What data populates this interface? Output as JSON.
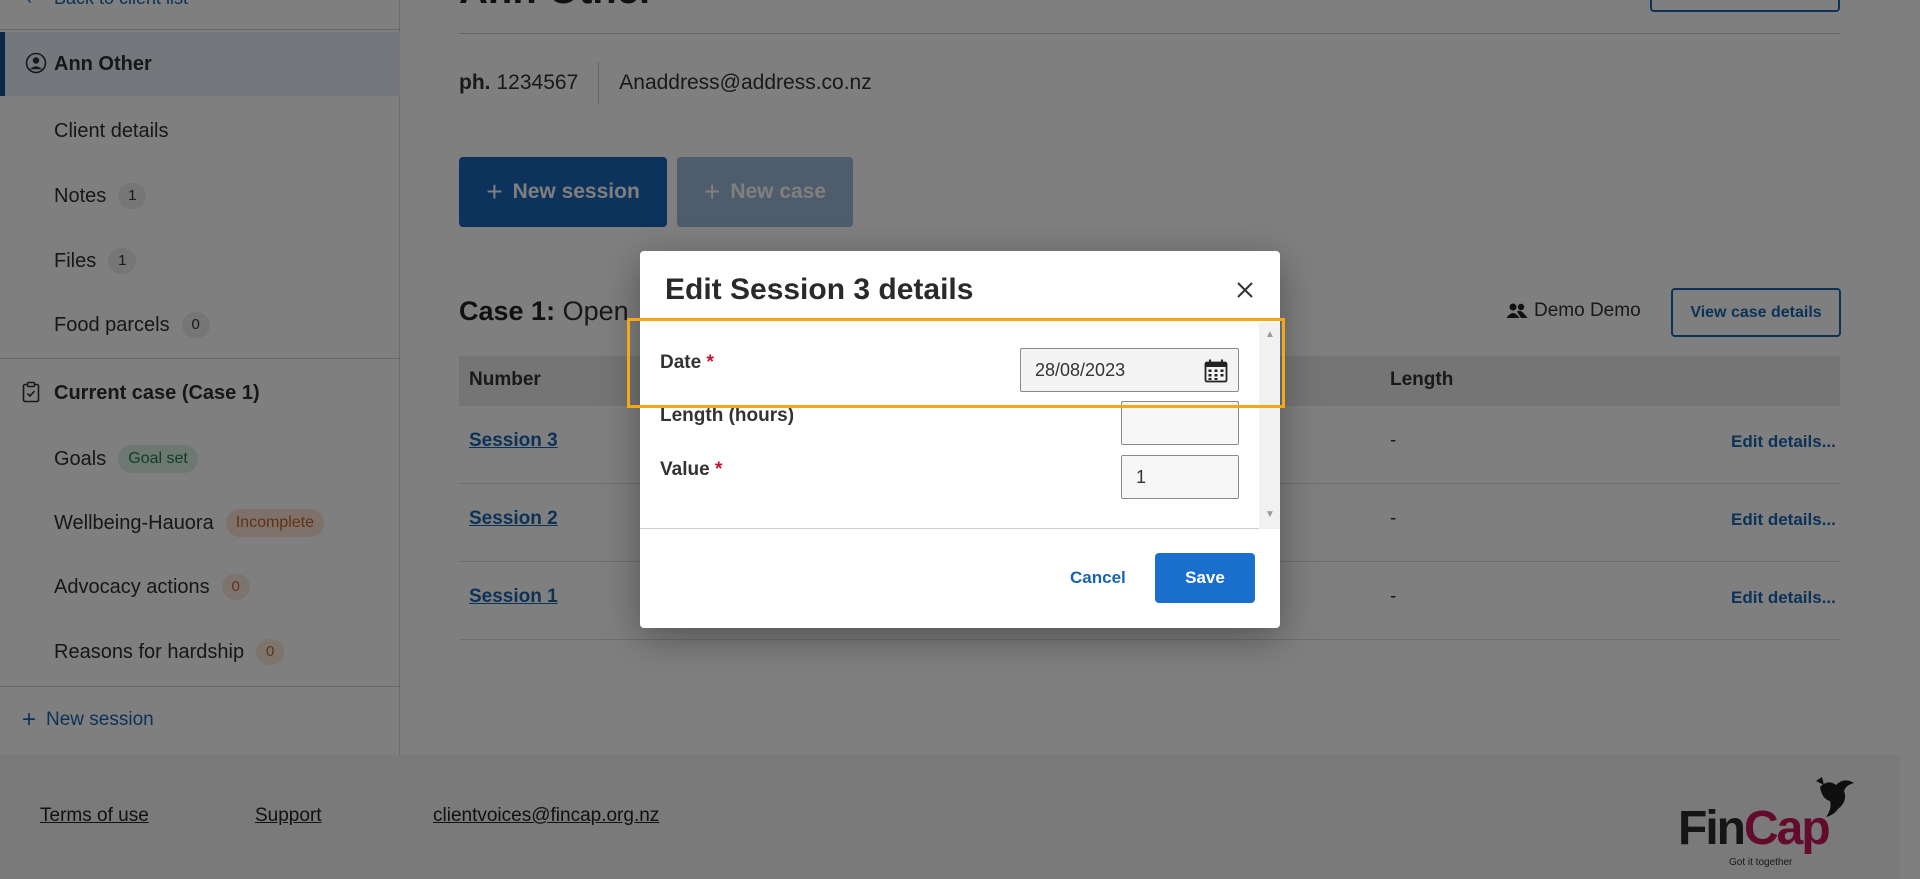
{
  "sidebar": {
    "back_label": "Back to client list",
    "client_name": "Ann Other",
    "items": [
      {
        "label": "Client details"
      },
      {
        "label": "Notes",
        "count": "1"
      },
      {
        "label": "Files",
        "count": "1"
      },
      {
        "label": "Food parcels",
        "count": "0"
      }
    ],
    "current_case": "Current case (Case 1)",
    "case_items": [
      {
        "label": "Goals",
        "tag": "Goal set"
      },
      {
        "label": "Wellbeing-Hauora",
        "tag": "Incomplete"
      },
      {
        "label": "Advocacy actions",
        "count": "0"
      },
      {
        "label": "Reasons for hardship",
        "count": "0"
      }
    ],
    "new_session": "New session"
  },
  "header": {
    "title": "Ann Other",
    "phone_prefix": "ph.",
    "phone": "1234567",
    "email": "Anaddress@address.co.nz"
  },
  "actions": {
    "new_session": "New session",
    "new_case": "New case"
  },
  "case": {
    "title_bold": "Case 1:",
    "title_rest": "Open",
    "owner": "Demo Demo",
    "view_details": "View case details"
  },
  "table": {
    "columns": [
      "Number",
      "Length"
    ],
    "rows": [
      {
        "session": "Session 3",
        "length": "-",
        "action": "Edit details..."
      },
      {
        "session": "Session 2",
        "length": "-",
        "action": "Edit details..."
      },
      {
        "session": "Session 1",
        "length": "-",
        "action": "Edit details..."
      }
    ]
  },
  "footer": {
    "terms": "Terms of use",
    "support": "Support",
    "email": "clientvoices@fincap.org.nz",
    "logo_fin": "Fin",
    "logo_cap": "Cap",
    "logo_tagline": "Got it together"
  },
  "modal": {
    "title": "Edit Session 3 details",
    "date_label": "Date",
    "date_value": "28/08/2023",
    "length_label": "Length (hours)",
    "length_value": "",
    "value_label": "Value",
    "value_value": "1",
    "required_mark": "*",
    "cancel": "Cancel",
    "save": "Save"
  },
  "colors": {
    "accent": "#1b64b8",
    "highlight": "#f2a818",
    "brand_pink": "#c5165b"
  }
}
